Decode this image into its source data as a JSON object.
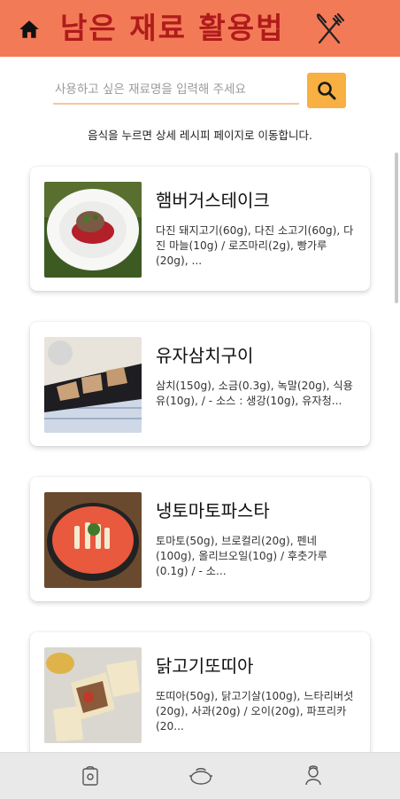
{
  "header": {
    "title": "남은 재료 활용법",
    "home_icon": "home-icon",
    "logo_icon": "fork-knife-icon",
    "background": "#f37a57",
    "title_color": "#b01b1b"
  },
  "search": {
    "placeholder": "사용하고 싶은 재료명을 입력해 주세요",
    "value": "",
    "button_icon": "search-icon",
    "button_color": "#f7b041"
  },
  "info_text": "음식을 누르면 상세 레시피 페이지로 이동합니다.",
  "recipes": [
    {
      "name": "햄버거스테이크",
      "ingredients": "다진 돼지고기(60g), 다진 소고기(60g), 다진 마늘(10g) / 로즈마리(2g), 빵가루(20g), ..."
    },
    {
      "name": "유자삼치구이",
      "ingredients": "삼치(150g), 소금(0.3g), 녹말(20g), 식용유(10g), / - 소스 : 생강(10g), 유자청..."
    },
    {
      "name": "냉토마토파스타",
      "ingredients": "토마토(50g), 브로컬리(20g), 펜네(100g), 올리브오일(10g) / 후춧가루(0.1g) / - 소..."
    },
    {
      "name": "닭고기또띠아",
      "ingredients": "또띠아(50g), 닭고기살(100g), 느타리버섯(20g), 사과(20g) / 오이(20g), 파프리카(20..."
    }
  ],
  "bottom_nav": [
    {
      "icon": "recipe-book-icon"
    },
    {
      "icon": "cooking-pot-icon"
    },
    {
      "icon": "chef-icon"
    }
  ]
}
